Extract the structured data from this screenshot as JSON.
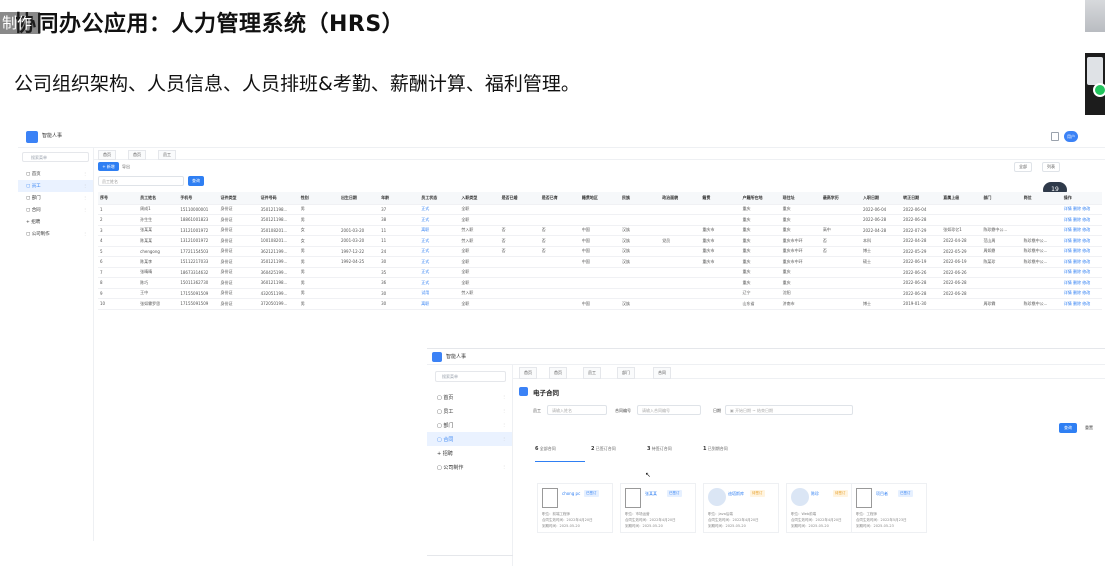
{
  "slide": {
    "title": "协同办公应用：人力管理系统（HRS）",
    "subtitle": "公司组织架构、人员信息、人员排班&考勤、薪酬计算、福利管理。",
    "overlay_text": "制作"
  },
  "s1": {
    "app_name": "智能人事",
    "avatar_text": "用户",
    "sidebar_search": "搜索菜单",
    "nav": [
      {
        "label": "首页"
      },
      {
        "label": "员工"
      },
      {
        "label": "部门"
      },
      {
        "label": "合同"
      },
      {
        "label": "招聘"
      },
      {
        "label": "公司制作"
      }
    ],
    "tabs": [
      "首页",
      "首页",
      "员工"
    ],
    "add_button": "+ 新增",
    "export_button": "导出",
    "filter_placeholder": "员工姓名",
    "filter_button": "查询",
    "right_selects": [
      "全部",
      "列表"
    ],
    "badge": "19",
    "columns": [
      "序号",
      "员工姓名",
      "手机号",
      "证件类型",
      "证件号码",
      "性别",
      "出生日期",
      "年龄",
      "员工状态",
      "入职类型",
      "是否已婚",
      "是否已育",
      "籍贯地区",
      "民族",
      "政治面貌",
      "籍贯",
      "户籍所在地",
      "现住址",
      "最高学历",
      "入职日期",
      "转正日期",
      "直属上级",
      "部门",
      "岗位",
      "操作"
    ],
    "rows": [
      [
        "1",
        "周成1",
        "15110000001",
        "身份证",
        "350121198...",
        "男",
        "",
        "37",
        "正式",
        "全职",
        "",
        "",
        "",
        "",
        "",
        "",
        "重庆",
        "重庆",
        "",
        "2022-06-04",
        "2022-06-04",
        "",
        "",
        "",
        "详情 删除 修改"
      ],
      [
        "2",
        "孙生生",
        "18861001823",
        "身份证",
        "350121198...",
        "男",
        "",
        "38",
        "正式",
        "全职",
        "",
        "",
        "",
        "",
        "",
        "",
        "重庆",
        "重庆",
        "",
        "2022-06-28",
        "2022-06-28",
        "",
        "",
        "",
        "详情 删除 修改"
      ],
      [
        "3",
        "张某某",
        "13121001972",
        "身份证",
        "350108201...",
        "女",
        "2001-03-20",
        "11",
        "离职",
        "劳入职",
        "否",
        "否",
        "中国",
        "汉族",
        "",
        "重庆市",
        "重庆",
        "重庆",
        "高中",
        "2022-04-28",
        "2022-07-29",
        "张如珍亿1",
        "陈珍鼎中公...",
        "",
        "详情 删除 修改"
      ],
      [
        "4",
        "陈某某",
        "13121001972",
        "身份证",
        "100108201...",
        "女",
        "2001-03-20",
        "11",
        "正式",
        "劳入职",
        "否",
        "否",
        "中国",
        "汉族",
        "党员",
        "重庆市",
        "重庆",
        "重庆市中环",
        "否",
        "本科",
        "2022-04-28",
        "2022-04-28",
        "范山周",
        "陈珍鼎中公...",
        "详情 删除 修改"
      ],
      [
        "5",
        "chengong",
        "17721154503",
        "身份证",
        "362121199...",
        "男",
        "1997-12-22",
        "24",
        "正式",
        "全职",
        "否",
        "否",
        "中国",
        "汉族",
        "",
        "重庆市",
        "重庆",
        "重庆市中环",
        "否",
        "博士",
        "2022-05-29",
        "2022-05-29",
        "周如鼎",
        "陈珍鼎中公...",
        "详情 删除 修改"
      ],
      [
        "6",
        "陈某李",
        "15112217033",
        "身份证",
        "350121199...",
        "男",
        "1992-04-25",
        "30",
        "正式",
        "全职",
        "",
        "",
        "中国",
        "汉族",
        "",
        "重庆市",
        "重庆",
        "重庆市中环",
        "",
        "硕士",
        "2022-06-19",
        "2022-06-19",
        "陈某珍",
        "陈珍鼎中公...",
        "详情 删除 修改"
      ],
      [
        "7",
        "张晴晴",
        "18673314632",
        "身份证",
        "360425199...",
        "男",
        "",
        "35",
        "正式",
        "全职",
        "",
        "",
        "",
        "",
        "",
        "",
        "重庆",
        "重庆",
        "",
        "",
        "2022-06-26",
        "2022-06-26",
        "",
        "",
        "详情 删除 修改"
      ],
      [
        "8",
        "陈巧",
        "15011362730",
        "身份证",
        "360121198...",
        "男",
        "",
        "36",
        "正式",
        "全职",
        "",
        "",
        "",
        "",
        "",
        "",
        "重庆",
        "重庆",
        "",
        "",
        "2022-06-28",
        "2022-06-28",
        "",
        "",
        "详情 删除 修改"
      ],
      [
        "9",
        "王中",
        "17155091509",
        "身份证",
        "432051199...",
        "男",
        "",
        "30",
        "试用",
        "劳入职",
        "",
        "",
        "",
        "",
        "",
        "",
        "辽宁",
        "沈阳",
        "",
        "",
        "2022-06-28",
        "2022-06-28",
        "",
        "",
        "详情 删除 修改"
      ],
      [
        "10",
        "张如霖罗思",
        "17155091509",
        "身份证",
        "372050199...",
        "男",
        "",
        "30",
        "离职",
        "全职",
        "",
        "",
        "中国",
        "汉族",
        "",
        "",
        "山东省",
        "济南市",
        "",
        "博士",
        "2019-01-30",
        "",
        "周珍霖",
        "陈珍鼎中公...",
        "详情 删除 修改"
      ]
    ]
  },
  "s2": {
    "app_name": "智能人事",
    "sidebar_search": "搜索菜单",
    "nav": [
      {
        "label": "首页"
      },
      {
        "label": "员工"
      },
      {
        "label": "部门"
      },
      {
        "label": "合同"
      },
      {
        "label": "招聘"
      },
      {
        "label": "公司制作"
      }
    ],
    "tabs": [
      "首页",
      "首页",
      "员工",
      "部门",
      "合同"
    ],
    "heading": "电子合同",
    "filters": {
      "employee_label": "员工",
      "employee_placeholder": "请输入姓名",
      "contract_no_label": "合同编号",
      "contract_no_placeholder": "请输入合同编号",
      "date_label": "日期",
      "date_start_placeholder": "开始日期",
      "date_sep": "~",
      "date_end_placeholder": "结束日期",
      "search_button": "查询",
      "reset_button": "重置"
    },
    "stats": [
      {
        "num": "6",
        "label": "全部合同"
      },
      {
        "num": "2",
        "label": "已签订合同"
      },
      {
        "num": "3",
        "label": "待签订合同"
      },
      {
        "num": "1",
        "label": "已到期合同"
      }
    ],
    "cursor": "↖",
    "cards": [
      {
        "name": "chong pc",
        "tag": "已签订",
        "lines": [
          "职位：前端工程师",
          "合同生效时间：2022年4月20日",
          "到期时间：2025-05-20"
        ]
      },
      {
        "name": "张某某",
        "tag": "已签订",
        "lines": [
          "职位：市场运营",
          "合同生效时间：2022年4月20日",
          "到期时间：2025-05-20"
        ]
      },
      {
        "name": "迪塔斯库",
        "tag": "待签订",
        "lines": [
          "职位：Java后端",
          "合同生效时间：2022年4月20日",
          "到期时间：2025-05-20"
        ]
      },
      {
        "name": "陈珍",
        "tag": "待签订",
        "lines": [
          "职位：Web前端",
          "合同生效时间：2022年4月20日",
          "到期时间：2025-05-20"
        ]
      },
      {
        "name": "项目者",
        "tag": "已签订",
        "lines": [
          "职位：工程师",
          "合同生效时间：2022年5月23日",
          "到期时间：2025-05-23"
        ]
      }
    ]
  },
  "colors": {
    "accent": "#2f7ff3",
    "tag_signed_bg": "#e6f0ff",
    "tag_signed_fg": "#2f7ff3",
    "tag_pending_bg": "#fff4e0",
    "tag_pending_fg": "#e69a1c"
  }
}
